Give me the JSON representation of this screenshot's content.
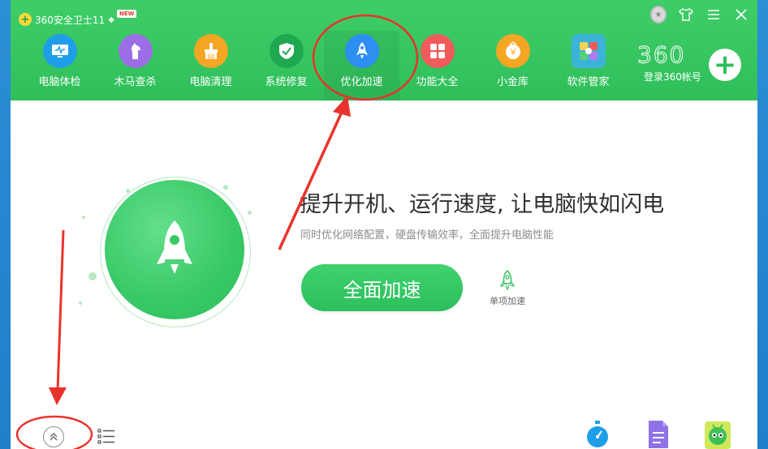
{
  "app": {
    "title": "360安全卫士11",
    "badge": "NEW"
  },
  "nav": {
    "items": [
      {
        "label": "电脑体检",
        "icon": "monitor-icon",
        "color": "#1e9ee8"
      },
      {
        "label": "木马查杀",
        "icon": "horse-icon",
        "color": "#9b6ee6"
      },
      {
        "label": "电脑清理",
        "icon": "broom-icon",
        "color": "#f5a623"
      },
      {
        "label": "系统修复",
        "icon": "shield-icon",
        "color": "#1fa84f"
      },
      {
        "label": "优化加速",
        "icon": "rocket-icon",
        "color": "#2d8ff2",
        "active": true
      },
      {
        "label": "功能大全",
        "icon": "grid-icon",
        "color": "#f25b5b"
      },
      {
        "label": "小金库",
        "icon": "coin-icon",
        "color": "#f5a623"
      },
      {
        "label": "软件管家",
        "icon": "app-store-icon",
        "color": "#3bb3d9"
      }
    ]
  },
  "brand": {
    "logo_text": "360",
    "login_label": "登录360帐号"
  },
  "main": {
    "headline": "提升开机、运行速度, 让电脑快如闪电",
    "subline": "同时优化网络配置，硬盘传输效率，全面提升电脑性能",
    "primary_button": "全面加速",
    "single_accel_label": "单项加速"
  },
  "colors": {
    "brand_green": "#2fbf5a",
    "annotation_red": "#e8332c"
  }
}
